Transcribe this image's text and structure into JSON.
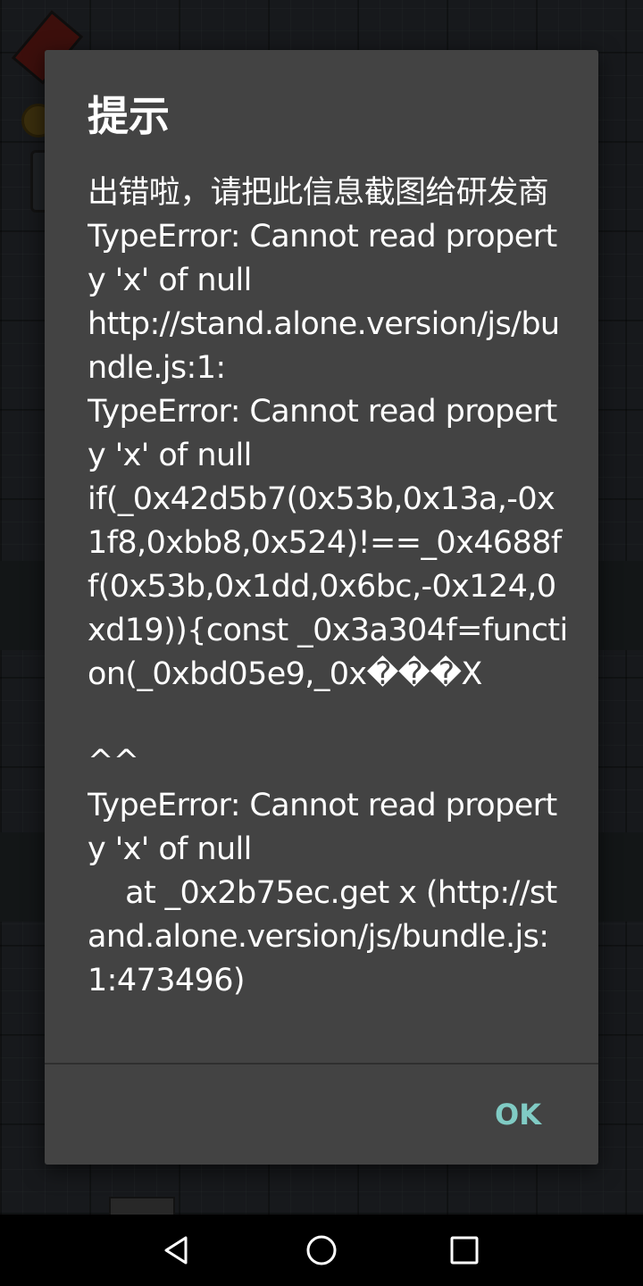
{
  "dialog": {
    "title": "提示",
    "message": "出错啦，请把此信息截图给研发商\nTypeError: Cannot read property 'x' of null\nhttp://stand.alone.version/js/bundle.js:1:\nTypeError: Cannot read property 'x' of null\nif(_0x42d5b7(0x53b,0x13a,-0x1f8,0xbb8,0x524)!==_0x4688ff(0x53b,0x1dd,0x6bc,-0x124,0xd19)){const _0x3a304f=function(_0xbd05e9,_0x���X\n\n^^\nTypeError: Cannot read property 'x' of null\n    at _0x2b75ec.get x (http://stand.alone.version/js/bundle.js:1:473496)",
    "ok_label": "OK"
  },
  "nav_bar": {
    "back_icon": "back-triangle-icon",
    "home_icon": "home-circle-icon",
    "recents_icon": "recents-square-icon"
  },
  "colors": {
    "dialog_background": "#434343",
    "accent": "#80cbc4",
    "text": "#ffffff",
    "nav_bar": "#000000"
  }
}
